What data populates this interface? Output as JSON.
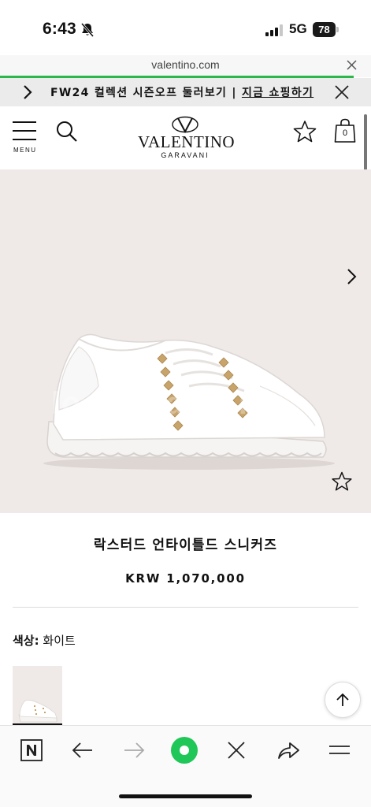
{
  "status_bar": {
    "time": "6:43",
    "network": "5G",
    "battery": "78"
  },
  "browser": {
    "url": "valentino.com"
  },
  "promo": {
    "text_prefix": "FW24 컬렉션 시즌오프 둘러보기 | ",
    "link": "지금 쇼핑하기"
  },
  "header": {
    "menu_label": "MENU",
    "logo_main": "VALENTINO",
    "logo_sub": "GARAVANI",
    "bag_count": "0"
  },
  "product": {
    "watermark": "loongbang-ra",
    "name": "락스터드 언타이틀드 스니커즈",
    "price": "KRW 1,070,000",
    "color_label": "색상:",
    "color_value": "화이트"
  },
  "colors": {
    "accent_green": "#2db64a",
    "image_background": "#efeae8",
    "stud_gold": "#c8a46a"
  },
  "icons": [
    "bell-off-icon",
    "signal-icon",
    "close-icon",
    "chevron-right-icon",
    "menu-icon",
    "search-icon",
    "star-icon",
    "bag-icon",
    "arrow-up-icon",
    "naver-icon",
    "back-arrow-icon",
    "forward-arrow-icon",
    "record-icon",
    "share-icon",
    "hamburger-icon"
  ]
}
